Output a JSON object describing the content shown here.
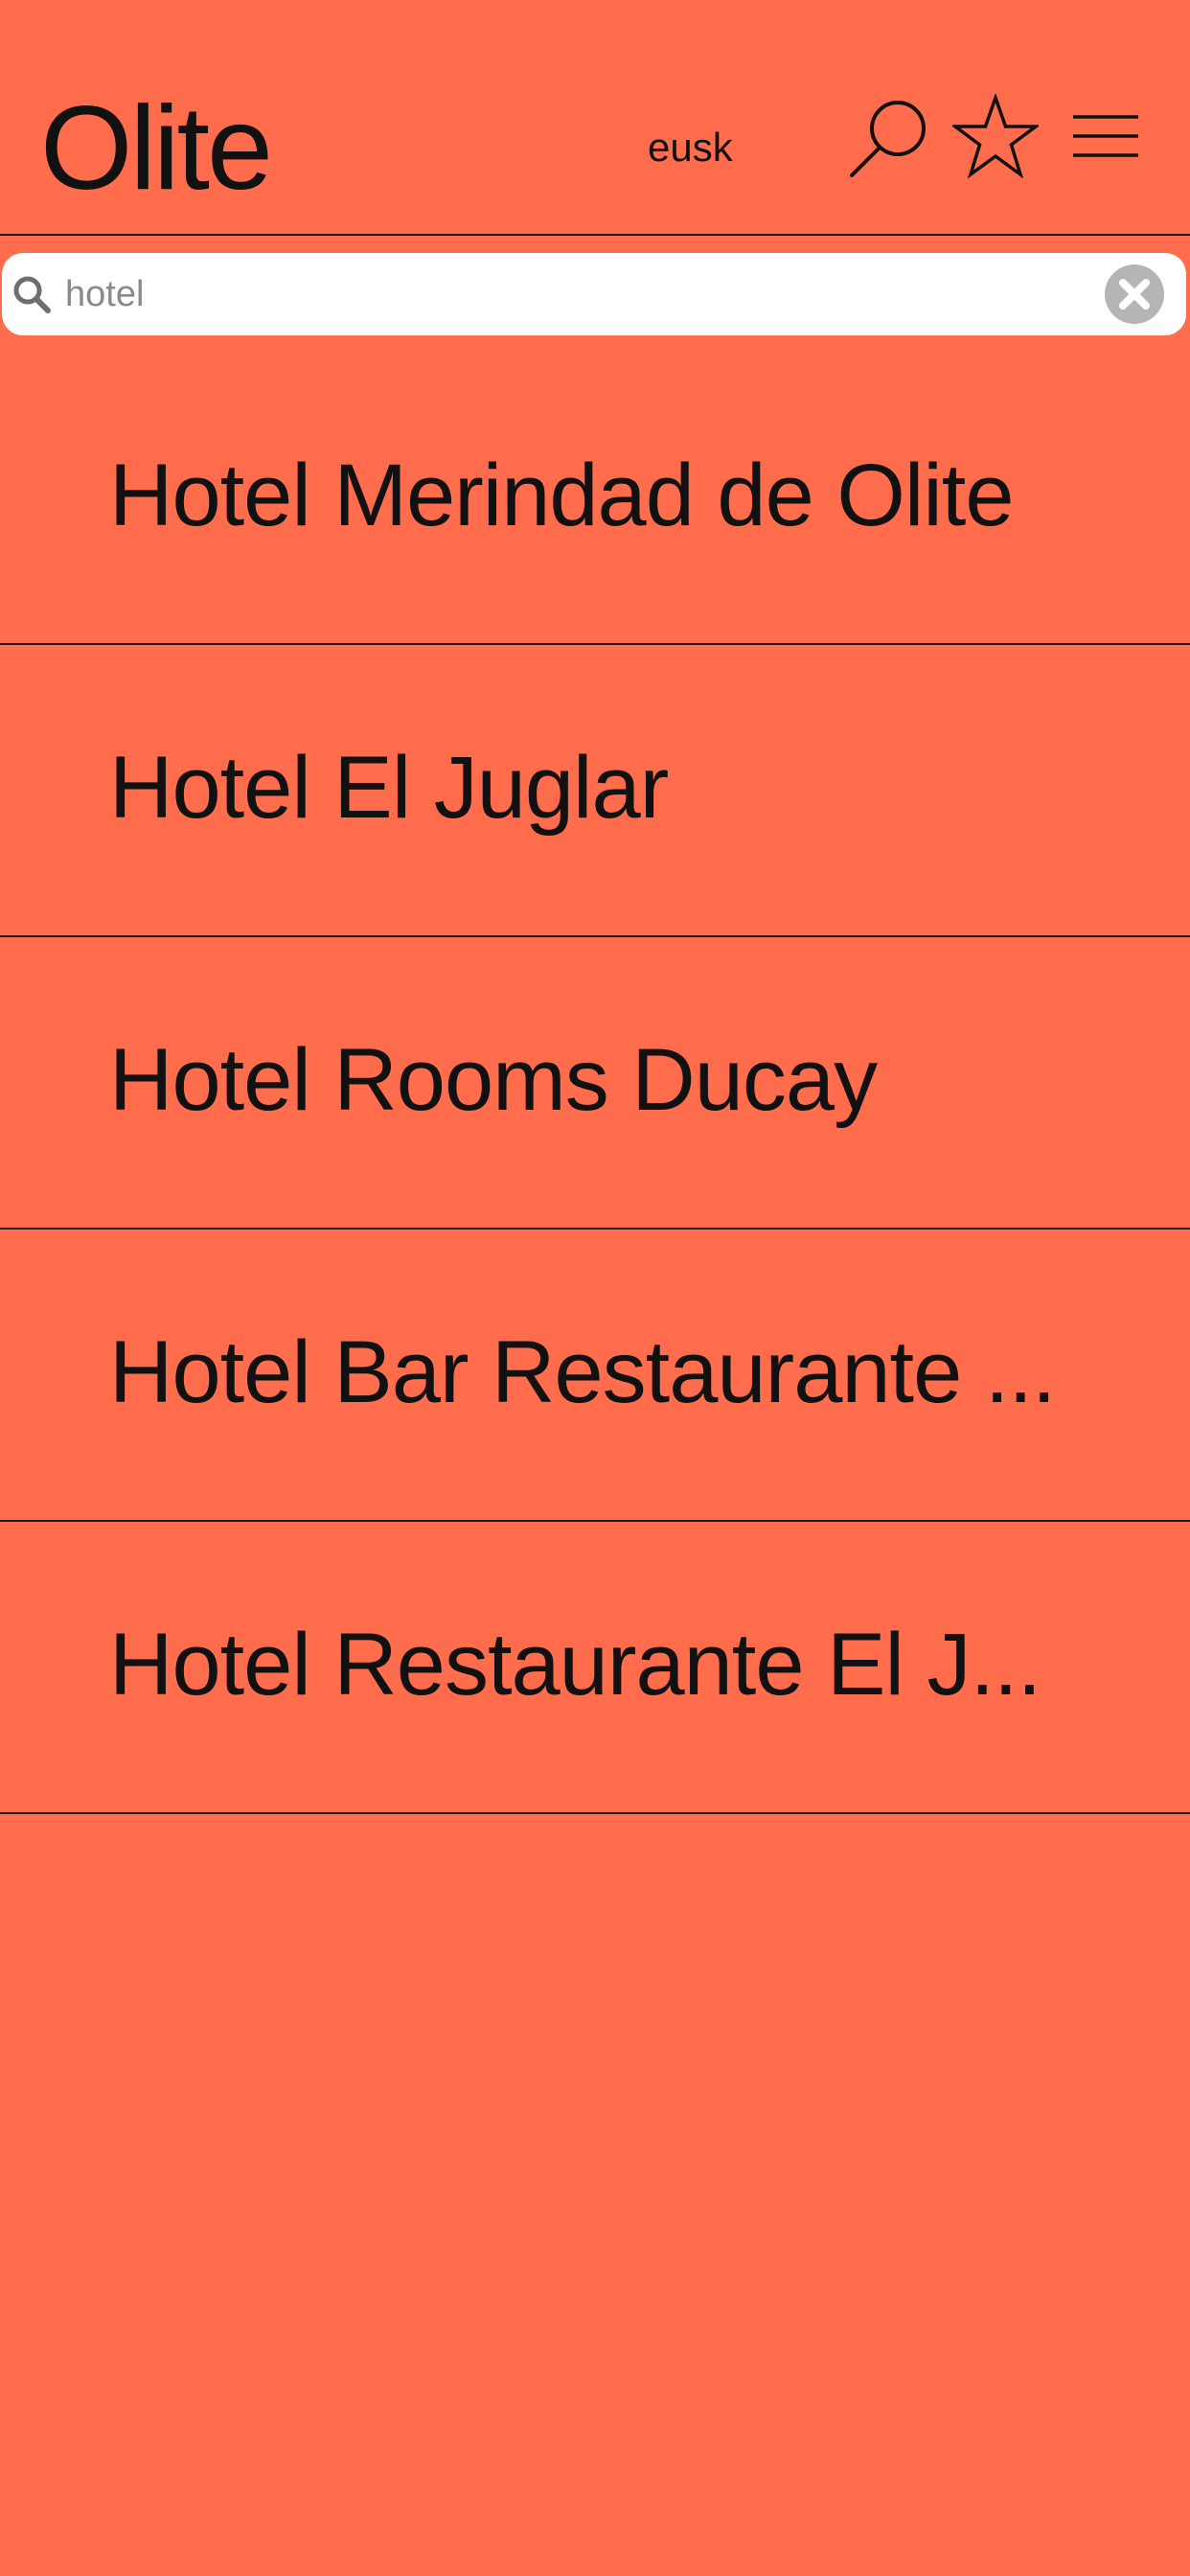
{
  "colors": {
    "background": "#FF6D4D",
    "text": "#111111",
    "divider": "#1a1a1a",
    "searchbar": "#FFFFFF",
    "placeholder_text": "#8a8a8a",
    "clear_icon": "#B5B5B5"
  },
  "header": {
    "logo": "Olite",
    "language_label": "eusk",
    "icons": [
      "search-icon",
      "star-icon",
      "hamburger-menu-icon"
    ]
  },
  "search": {
    "value": "hotel",
    "icon": "magnifier-icon",
    "clear_icon": "clear-circle-icon"
  },
  "results": [
    {
      "label": "Hotel Merindad de Olite"
    },
    {
      "label": "Hotel El Juglar"
    },
    {
      "label": "Hotel Rooms Ducay"
    },
    {
      "label": "Hotel Bar Restaurante ..."
    },
    {
      "label": "Hotel Restaurante El J..."
    }
  ]
}
